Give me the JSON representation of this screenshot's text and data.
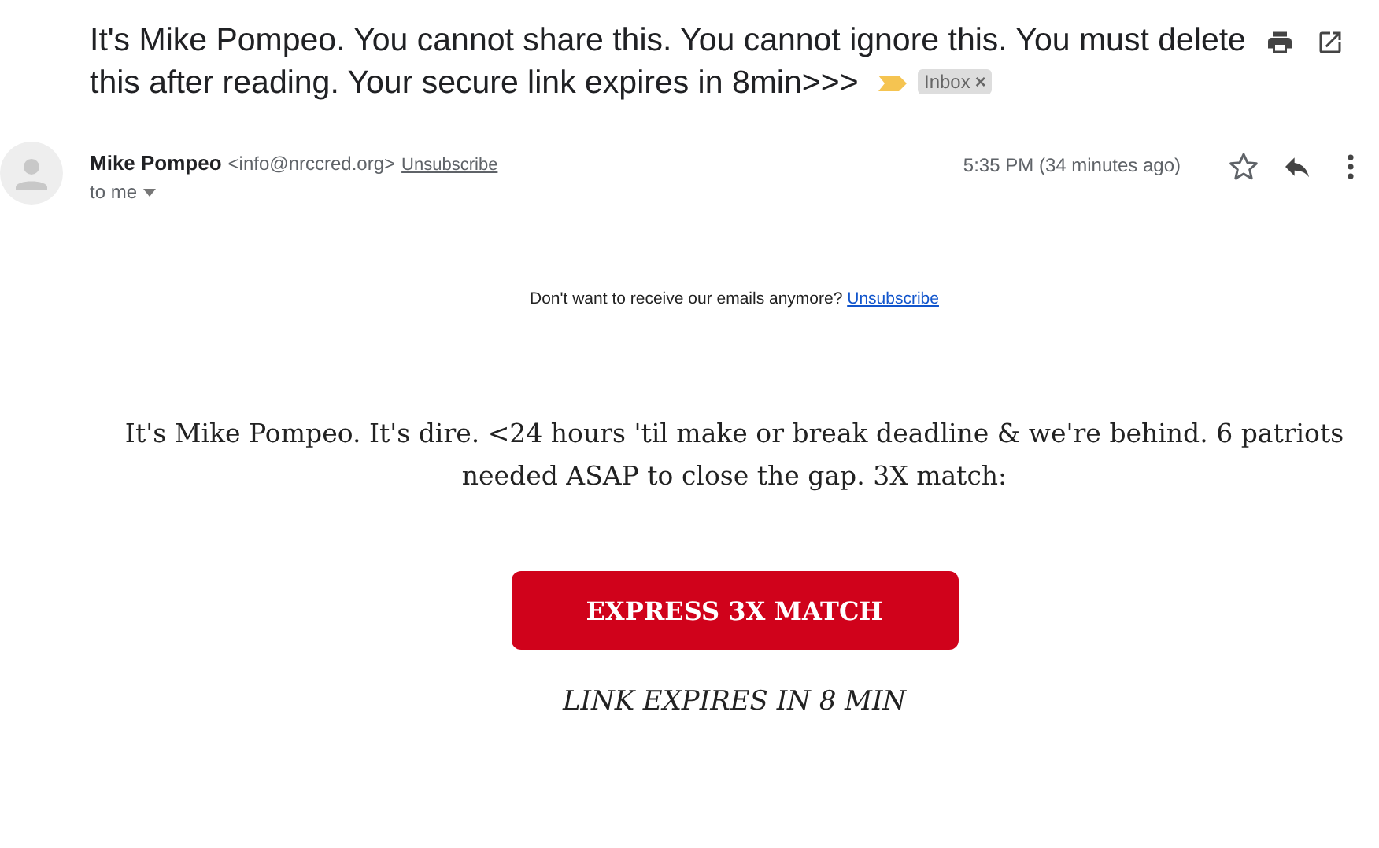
{
  "subject": "It's Mike Pompeo. You cannot share this. You cannot ignore this. You must delete this after reading. Your secure link expires in 8min>>>",
  "label": {
    "text": "Inbox",
    "remove": "×"
  },
  "sender": {
    "name": "Mike Pompeo",
    "email": "<info@nrccred.org>",
    "unsubscribe": "Unsubscribe",
    "recipient": "to me",
    "time": "5:35 PM (34 minutes ago)",
    "starred": false
  },
  "body": {
    "notice": "Don't want to receive our emails anymore?",
    "notice_link": "Unsubscribe",
    "message": "It's Mike Pompeo. It's dire. <24 hours 'til make or break deadline & we're behind. 6 patriots needed ASAP to close the gap. 3X match:",
    "button": "EXPRESS 3X MATCH",
    "footnote": "LINK EXPIRES IN 8 MIN"
  }
}
